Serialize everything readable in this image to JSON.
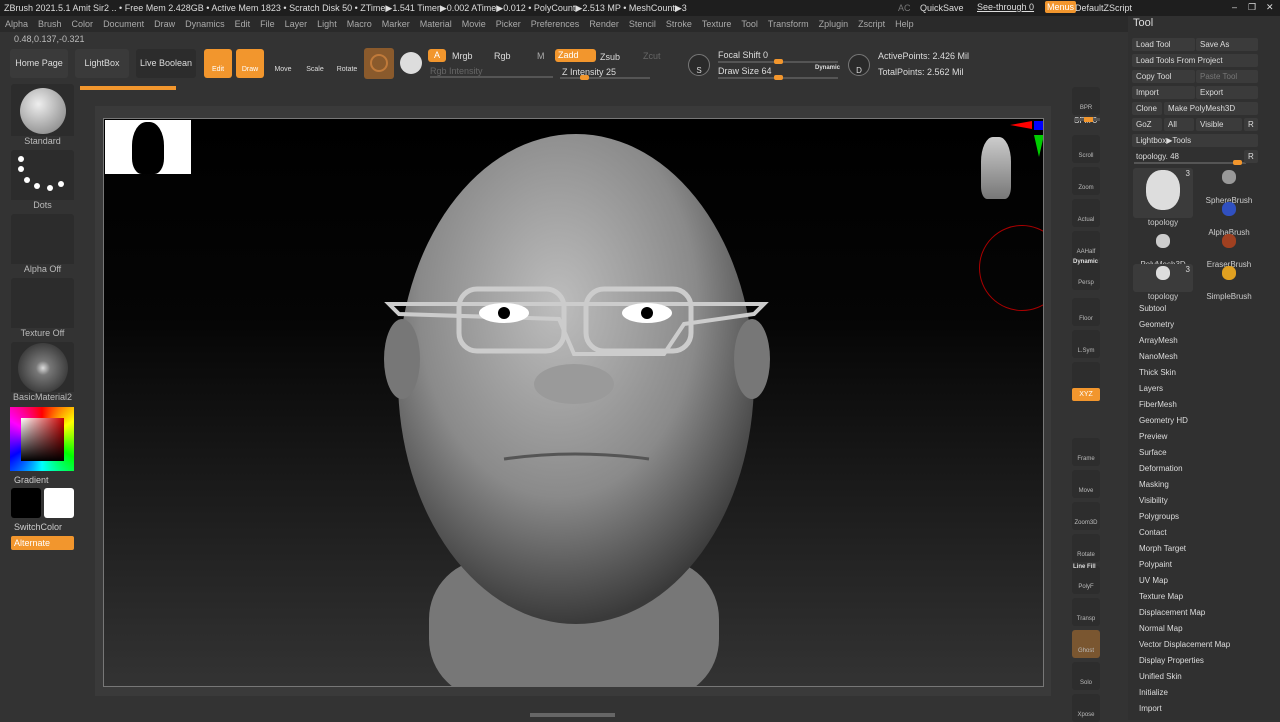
{
  "title_bar": {
    "text": "ZBrush 2021.5.1    Amit Sir2   .. • Free Mem 2.428GB • Active Mem 1823 • Scratch Disk 50 •  ZTime▶1.541 Timer▶0.002 ATime▶0.012 • PolyCount▶2.513 MP  • MeshCount▶3",
    "ac": "AC",
    "quicksave": "QuickSave",
    "see_through": "See-through  0",
    "menus": "Menus",
    "script": "DefaultZScript"
  },
  "menu": [
    "Alpha",
    "Brush",
    "Color",
    "Document",
    "Draw",
    "Dynamics",
    "Edit",
    "File",
    "Layer",
    "Light",
    "Macro",
    "Marker",
    "Material",
    "Movie",
    "Picker",
    "Preferences",
    "Render",
    "Stencil",
    "Stroke",
    "Texture",
    "Tool",
    "Transform",
    "Zplugin",
    "Zscript",
    "Help"
  ],
  "coords": "0.48,0.137,-0.321",
  "toolbar": {
    "home": "Home Page",
    "lightbox": "LightBox",
    "live_boolean": "Live Boolean",
    "edit": "Edit",
    "draw": "Draw",
    "move": "Move",
    "scale": "Scale",
    "rotate": "Rotate",
    "a": "A",
    "mrgb": "Mrgb",
    "rgb": "Rgb",
    "m": "M",
    "zadd": "Zadd",
    "zsub": "Zsub",
    "zcut": "Zcut",
    "rgb_intensity": "Rgb Intensity",
    "z_intensity": "Z Intensity 25",
    "focal_shift": "Focal Shift 0",
    "draw_size": "Draw Size 64",
    "dynamic": "Dynamic",
    "active_points": "ActivePoints: 2.426 Mil",
    "total_points": "TotalPoints: 2.562 Mil",
    "s": "S",
    "d": "D"
  },
  "sliders": {
    "z_intensity": 0.25,
    "draw_size": 0.5,
    "focal_shift": 0.5,
    "topology": 0.96,
    "spix": 0.6
  },
  "left_shelf": {
    "brush": "Standard",
    "stroke": "Dots",
    "alpha": "Alpha Off",
    "texture": "Texture Off",
    "material": "BasicMaterial2",
    "gradient": "Gradient",
    "switch_color": "SwitchColor",
    "alternate": "Alternate"
  },
  "right_shelf": [
    "BPR",
    "SPix 3",
    "Scroll",
    "Zoom",
    "Actual",
    "AAHalf",
    "Persp",
    "Floor",
    "L.Sym",
    "",
    "XYZ",
    "Frame",
    "Move",
    "Zoom3D",
    "Rotate",
    "PolyF",
    "Transp",
    "Ghost",
    "Solo",
    "Xpose"
  ],
  "right_shelf_extra": {
    "dynamic": "Dynamic",
    "line_fill": "Line Fill"
  },
  "tool_panel": {
    "title": "Tool",
    "load_tool": "Load Tool",
    "save_as": "Save As",
    "load_from_project": "Load Tools From Project",
    "copy_tool": "Copy Tool",
    "paste_tool": "Paste Tool",
    "import": "Import",
    "export": "Export",
    "clone": "Clone",
    "make_polymesh": "Make PolyMesh3D",
    "goz": "GoZ",
    "all": "All",
    "visible": "Visible",
    "r": "R",
    "lightbox_tools": "Lightbox▶Tools",
    "topology_slider": "topology. 48",
    "tools": [
      {
        "name": "topology",
        "count": "3"
      },
      {
        "name": "SphereBrush"
      },
      {
        "name": "AlphaBrush"
      },
      {
        "name": "PolyMesh3D"
      },
      {
        "name": "EraserBrush"
      },
      {
        "name": "topology",
        "count": "3"
      },
      {
        "name": "SimpleBrush"
      }
    ],
    "subpalettes": [
      "Subtool",
      "Geometry",
      "ArrayMesh",
      "NanoMesh",
      "Thick Skin",
      "Layers",
      "FiberMesh",
      "Geometry HD",
      "Preview",
      "Surface",
      "Deformation",
      "Masking",
      "Visibility",
      "Polygroups",
      "Contact",
      "Morph Target",
      "Polypaint",
      "UV Map",
      "Texture Map",
      "Displacement Map",
      "Normal Map",
      "Vector Displacement Map",
      "Display Properties",
      "Unified Skin",
      "Initialize",
      "Import"
    ]
  },
  "colors": {
    "accent": "#f2962d",
    "bg": "#333333"
  }
}
